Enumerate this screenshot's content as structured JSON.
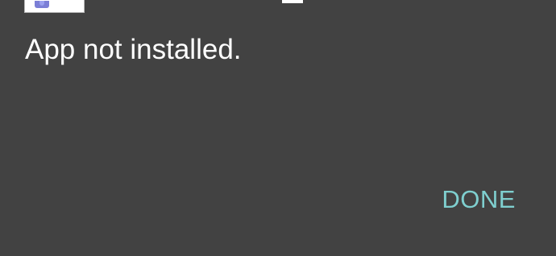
{
  "dialog": {
    "app_icon": "app-icon",
    "message": "App not installed.",
    "done_label": "DONE"
  },
  "colors": {
    "background": "#424242",
    "message_text": "#ffffff",
    "accent": "#80cbc4"
  }
}
